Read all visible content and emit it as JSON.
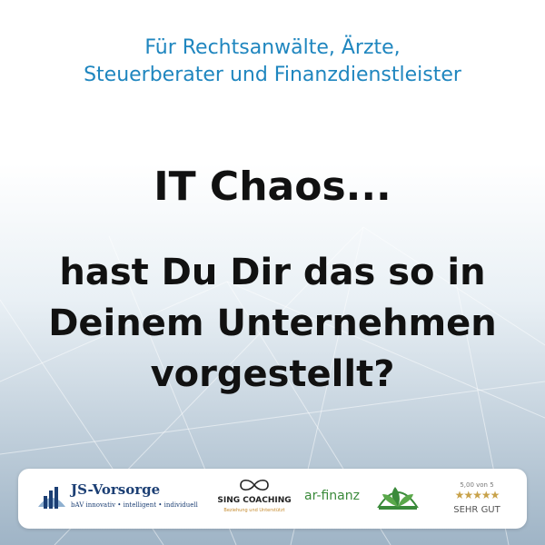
{
  "header": {
    "line1": "Für Rechtsanwälte, Ärzte,",
    "line2": "Steuerberater und Finanzdienstleister"
  },
  "headline": "IT Chaos...",
  "question": {
    "line1": "hast Du Dir das so in",
    "line2": "Deinem Unternehmen",
    "line3": "vorgestellt?"
  },
  "logos": {
    "js_vorsorge": {
      "name": "JS-Vorsorge",
      "tagline": "bAV innovativ • intelligent • individuell"
    },
    "sing_coaching": {
      "name": "SING COACHING",
      "tagline": "Beziehung und Unterstützt"
    },
    "ar_finanz": {
      "name": "ar-finanz"
    },
    "rating": {
      "score": "5,00 von 5",
      "stars": "★★★★★",
      "label": "SEHR GUT",
      "value": 5
    }
  },
  "colors": {
    "accent": "#1f86bf",
    "text": "#111111",
    "navy": "#1c3f74",
    "green": "#3a8a3a",
    "gold": "#c8a24a"
  }
}
